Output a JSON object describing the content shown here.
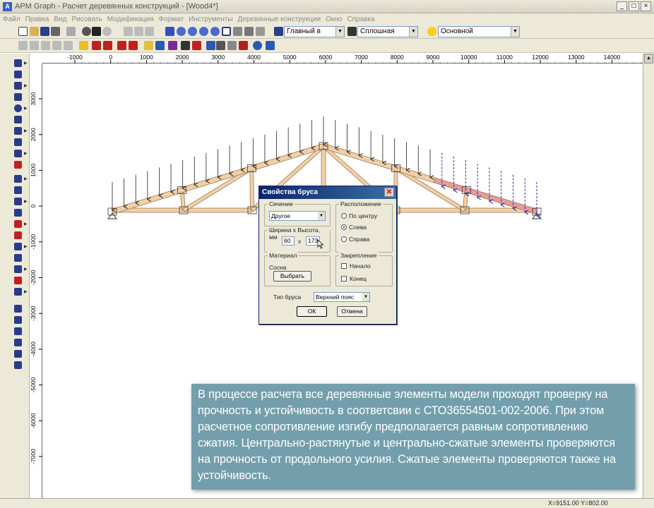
{
  "window": {
    "title": "APM Graph - Расчет деревянных конструкций - [Wood4*]",
    "controls": [
      "_",
      "□",
      "×"
    ]
  },
  "menu": [
    "Файл",
    "Правка",
    "Вид",
    "Рисовать",
    "Модификация",
    "Формат",
    "Инструменты",
    "Деревянные конструкции",
    "Окно",
    "Справка"
  ],
  "toolbar": {
    "layer_combo": "Главный в",
    "linetype_combo": "Сплошная",
    "style_combo": "Основной"
  },
  "ruler": {
    "top_labels": [
      "-1000",
      "0",
      "1000",
      "2000",
      "3000",
      "4000",
      "5000",
      "6000",
      "7000",
      "8000",
      "9000",
      "10000",
      "11000",
      "12000",
      "13000",
      "14000"
    ],
    "left_labels": [
      "3000",
      "2000",
      "1000",
      "0",
      "-1000",
      "-2000",
      "-3000",
      "-4000",
      "-5000",
      "-6000",
      "-7000"
    ]
  },
  "dialog": {
    "title": "Свойства бруса",
    "section_label": "Сечение",
    "section_value": "Другое",
    "size_label": "Ширина х Высота, мм",
    "width_value": "60",
    "times": "x",
    "height_value": "173",
    "placement_label": "Расположение",
    "placement_options": [
      "По центру",
      "Слева",
      "Справа"
    ],
    "material_label": "Материал",
    "material_value": "Сосна",
    "choose_button": "Выбрать",
    "fixing_label": "Закрепление",
    "fixing_options": [
      "Начало",
      "Конец"
    ],
    "beam_type_label": "Тип бруса",
    "beam_type_value": "Верхний пояс",
    "ok": "ОК",
    "cancel": "Отмена"
  },
  "caption": "В процессе расчета все деревянные элементы модели проходят проверку на прочность и устойчивость в соответсвии с СТО36554501-002-2006. При этом расчетное сопротивление изгибу предполагается равным сопротивлению сжатия. Центрально-растянутые и центрально-сжатые элементы проверяются на прочность от продольного усилия. Сжатые элементы проверяются также на устойчивость.",
  "status": {
    "coords": "X=9151.00 Y=802.00"
  },
  "colors": {
    "timber": "#f2cfa6",
    "timber_edge": "#9a7a58",
    "load_arrow": "#222222",
    "selected_load": "#1a1aa0",
    "selected_member": "#e89a9a"
  }
}
